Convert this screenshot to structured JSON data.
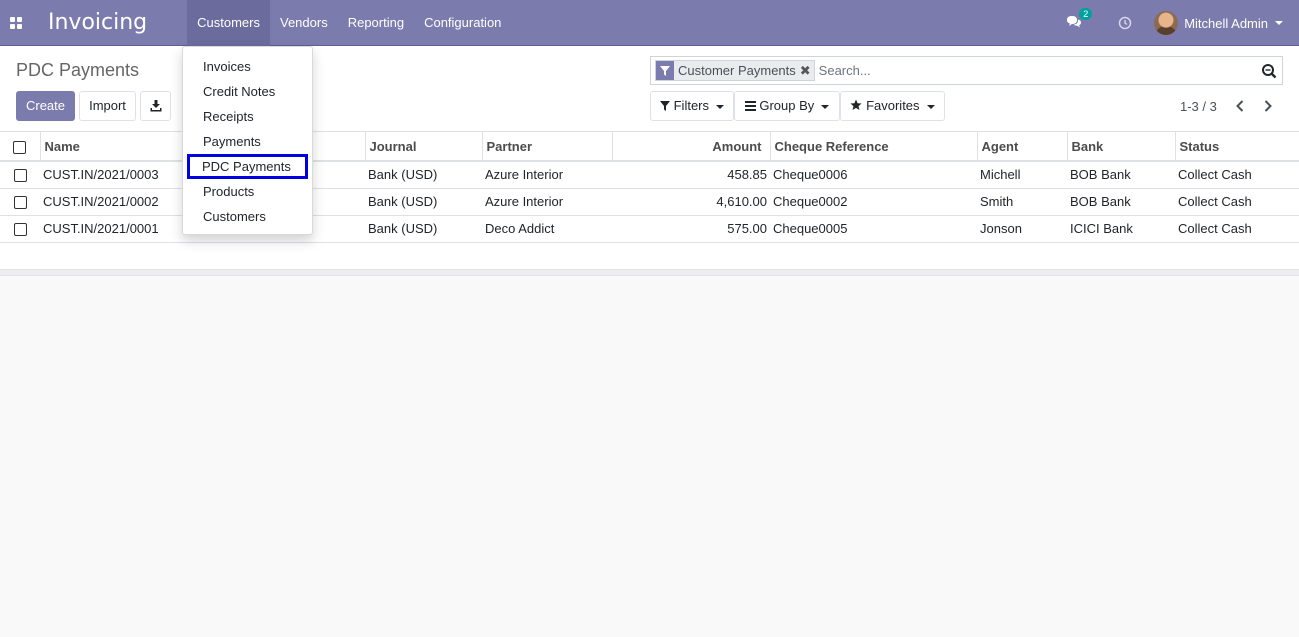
{
  "navbar": {
    "app_title": "Invoicing",
    "menu": [
      "Customers",
      "Vendors",
      "Reporting",
      "Configuration"
    ],
    "chat_count": "2",
    "user_name": "Mitchell Admin"
  },
  "dropdown": {
    "items": [
      "Invoices",
      "Credit Notes",
      "Receipts",
      "Payments",
      "PDC Payments",
      "Products",
      "Customers"
    ]
  },
  "control_panel": {
    "title": "PDC Payments",
    "create_label": "Create",
    "import_label": "Import",
    "facet_label": "Customer Payments",
    "search_placeholder": "Search...",
    "filters_label": "Filters",
    "group_by_label": "Group By",
    "favorites_label": "Favorites",
    "pager": "1-3 / 3"
  },
  "table": {
    "columns": [
      "Name",
      "Journal",
      "Partner",
      "Amount",
      "Cheque Reference",
      "Agent",
      "Bank",
      "Status"
    ],
    "rows": [
      {
        "name": "CUST.IN/2021/0003",
        "journal": "Bank (USD)",
        "partner": "Azure Interior",
        "amount": "458.85",
        "cheque": "Cheque0006",
        "agent": "Michell",
        "bank": "BOB Bank",
        "status": "Collect Cash"
      },
      {
        "name": "CUST.IN/2021/0002",
        "journal": "Bank (USD)",
        "partner": "Azure Interior",
        "amount": "4,610.00",
        "cheque": "Cheque0002",
        "agent": "Smith",
        "bank": "BOB Bank",
        "status": "Collect Cash"
      },
      {
        "name": "CUST.IN/2021/0001",
        "journal": "Bank (USD)",
        "partner": "Deco Addict",
        "amount": "575.00",
        "cheque": "Cheque0005",
        "agent": "Jonson",
        "bank": "ICICI Bank",
        "status": "Collect Cash"
      }
    ]
  },
  "colors": {
    "brand": "#7c7bad",
    "highlight": "#0000e0",
    "badge": "#00a09d"
  }
}
